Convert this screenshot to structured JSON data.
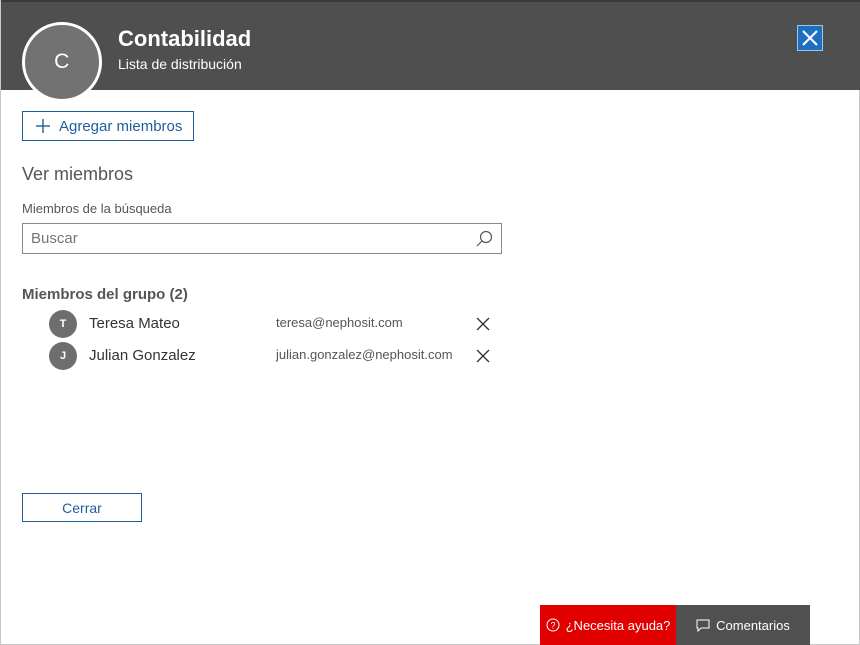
{
  "header": {
    "avatar_initial": "C",
    "title": "Contabilidad",
    "subtitle": "Lista de distribución"
  },
  "actions": {
    "add_members_label": "Agregar miembros",
    "close_label": "Cerrar"
  },
  "view": {
    "section_title": "Ver miembros",
    "search_label": "Miembros de la búsqueda",
    "search_placeholder": "Buscar"
  },
  "members": {
    "title": "Miembros del grupo (2)",
    "items": [
      {
        "initial": "T",
        "name": "Teresa Mateo",
        "email": "teresa@nephosit.com"
      },
      {
        "initial": "J",
        "name": "Julian Gonzalez",
        "email": "julian.gonzalez@nephosit.com"
      }
    ]
  },
  "footer": {
    "help_label": "¿Necesita ayuda?",
    "feedback_label": "Comentarios"
  },
  "colors": {
    "header_bg": "#4f4f4f",
    "accent": "#1f5e9e",
    "help_bg": "#e00000",
    "feedback_bg": "#505050"
  },
  "icons": {
    "close": "close-icon",
    "add": "plus-icon",
    "search": "search-icon",
    "remove": "remove-member-icon",
    "help": "question-circle-icon",
    "feedback": "comment-icon"
  }
}
